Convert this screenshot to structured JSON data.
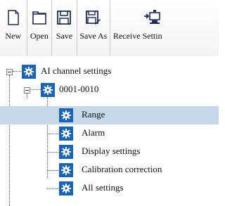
{
  "toolbar": {
    "buttons": [
      {
        "label": "New",
        "icon": "new-document-icon"
      },
      {
        "label": "Open",
        "icon": "open-folder-icon"
      },
      {
        "label": "Save",
        "icon": "save-disk-icon"
      },
      {
        "label": "Save As",
        "icon": "save-as-disk-icon"
      },
      {
        "label": "Receive Settin",
        "icon": "receive-settings-icon"
      }
    ]
  },
  "tree": {
    "root": {
      "label": "AI channel settings",
      "expanded": true
    },
    "group": {
      "label": "0001-0010",
      "expanded": true
    },
    "items": [
      {
        "label": "Range",
        "selected": true
      },
      {
        "label": "Alarm",
        "selected": false
      },
      {
        "label": "Display settings",
        "selected": false
      },
      {
        "label": "Calibration correction",
        "selected": false
      },
      {
        "label": "All settings",
        "selected": false
      }
    ],
    "colors": {
      "icon_bg": "#1565c0",
      "selected_bg": "#c5d9ea"
    }
  }
}
